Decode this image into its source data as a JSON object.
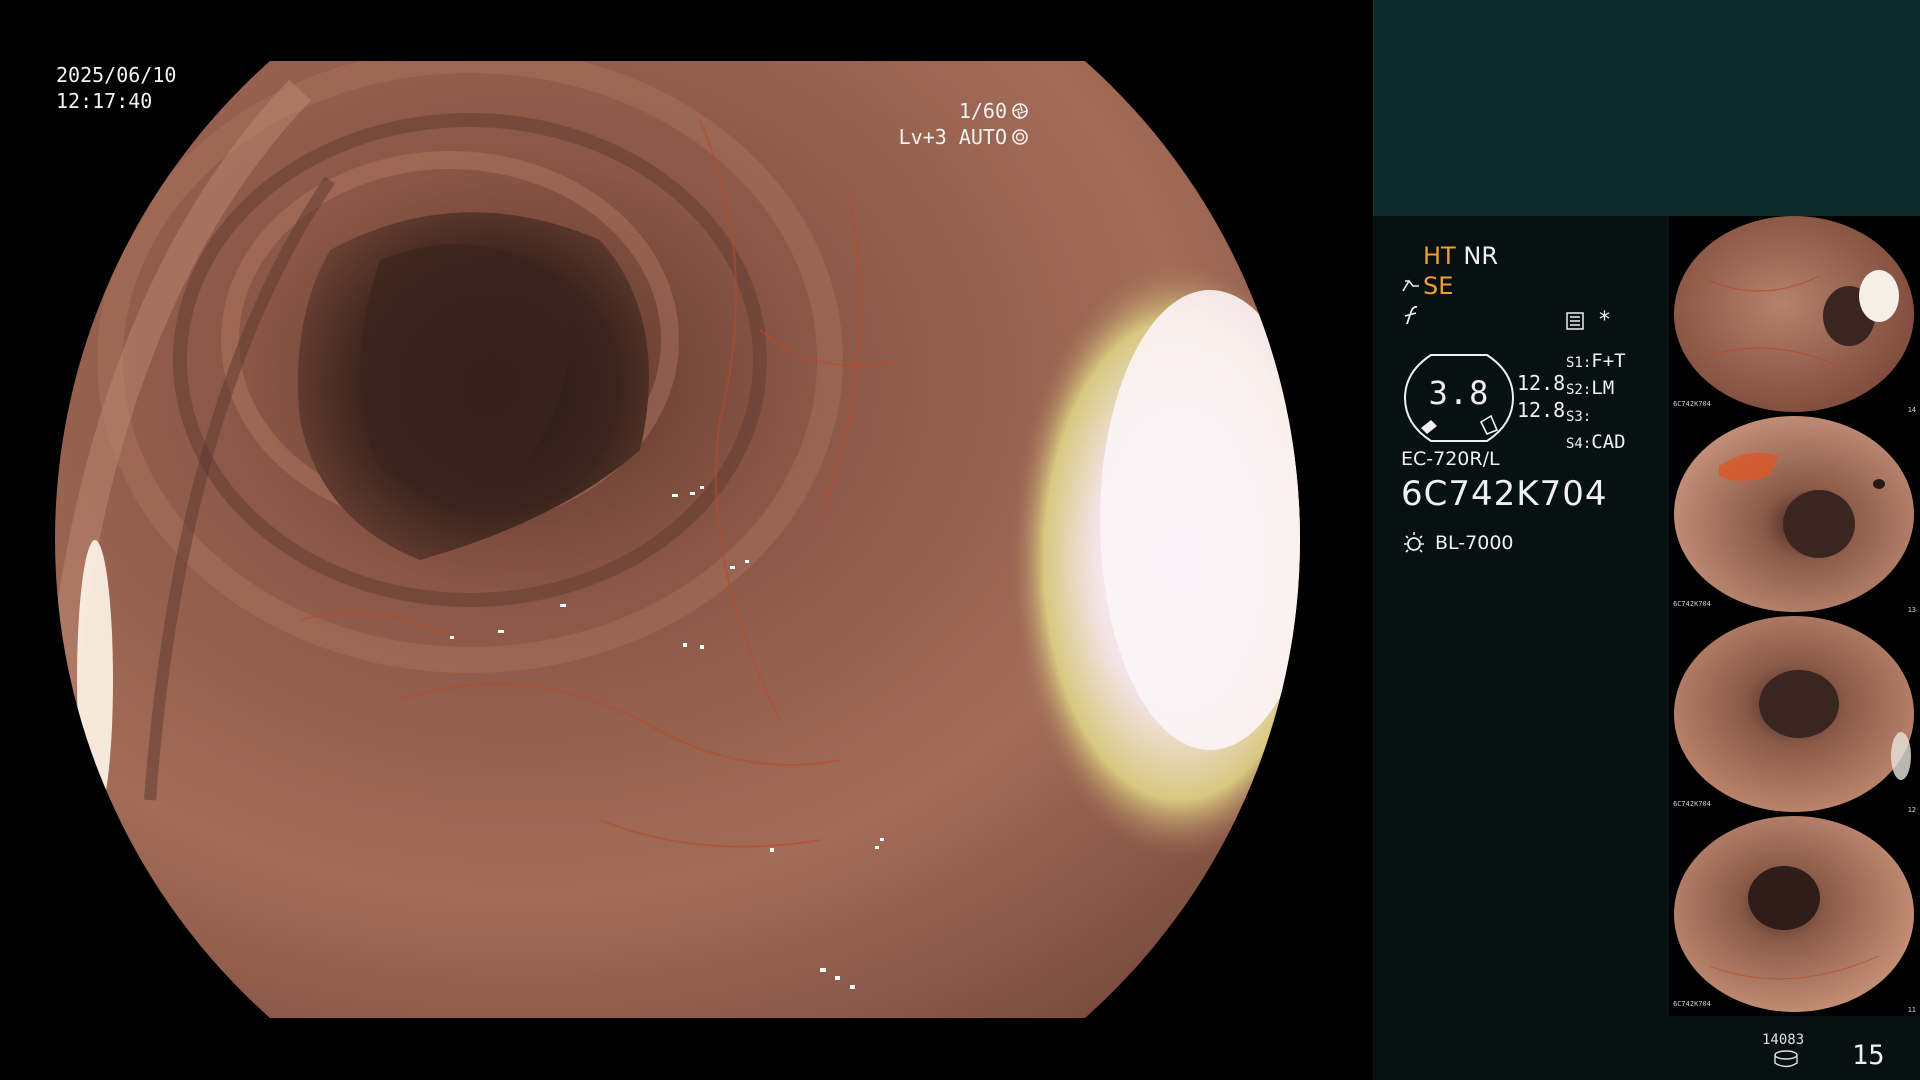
{
  "osd": {
    "date": "2025/06/10",
    "time": "12:17:40",
    "shutter": "1/60",
    "level": "Lv+3 AUTO"
  },
  "status": {
    "ht": "HT",
    "nr": "NR",
    "se": "SE",
    "asterisk": "*",
    "gauge_value": "3.8",
    "value_1": "12.8",
    "value_2": "12.8",
    "switches": [
      {
        "label": "S1:",
        "value": "F+T"
      },
      {
        "label": "S2:",
        "value": "LM"
      },
      {
        "label": "S3:",
        "value": ""
      },
      {
        "label": "S4:",
        "value": "CAD"
      }
    ],
    "scope_model": "EC-720R/L",
    "scope_serial": "6C742K704",
    "light_source": "BL-7000"
  },
  "thumbnails": [
    {
      "serial": "6C742K704",
      "index": "14"
    },
    {
      "serial": "6C742K704",
      "index": "13"
    },
    {
      "serial": "6C742K704",
      "index": "12"
    },
    {
      "serial": "6C742K704",
      "index": "11"
    }
  ],
  "footer": {
    "storage_count": "14083",
    "image_count": "15"
  },
  "colors": {
    "panel_bg": "#081112",
    "top_box": "#0d2a2b",
    "accent_orange": "#f0a030",
    "mucosa": "#9c6652"
  },
  "icons": [
    "shutter-icon",
    "auto-iris-icon",
    "structure-enhance-icon",
    "freeze-icon",
    "settings-icon",
    "light-source-icon",
    "disk-icon"
  ]
}
